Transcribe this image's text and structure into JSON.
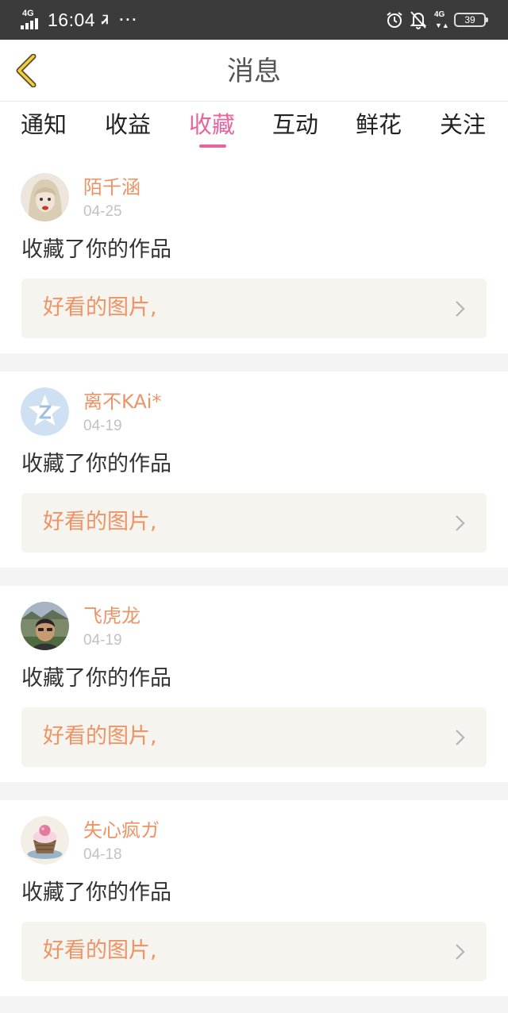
{
  "status_bar": {
    "network_left": "4G",
    "time": "16:04",
    "extra_icon": "Ꮨ",
    "dots": "···",
    "network_right": "4G",
    "battery": "39"
  },
  "header": {
    "title": "消息"
  },
  "tabs": [
    {
      "label": "通知"
    },
    {
      "label": "收益"
    },
    {
      "label": "收藏"
    },
    {
      "label": "互动"
    },
    {
      "label": "鲜花"
    },
    {
      "label": "关注"
    }
  ],
  "active_tab": "收藏",
  "colors": {
    "accent": "#e8649e",
    "username": "#ee9366",
    "work_title": "#ee9366",
    "date": "#c2c2c2",
    "status_bar": "#3b3b3b",
    "card_link_bg": "#f5f4ee"
  },
  "notifications": [
    {
      "username": "陌千涵",
      "date": "04-25",
      "action": "收藏了你的作品",
      "work_title": "好看的图片,",
      "avatar_icon": "avatar-girl-icon"
    },
    {
      "username": "离不KAi*",
      "date": "04-19",
      "action": "收藏了你的作品",
      "work_title": "好看的图片,",
      "avatar_icon": "qzone-default-avatar-icon"
    },
    {
      "username": "飞虎龙",
      "date": "04-19",
      "action": "收藏了你的作品",
      "work_title": "好看的图片,",
      "avatar_icon": "avatar-man-icon"
    },
    {
      "username": "失心疯ガ",
      "date": "04-18",
      "action": "收藏了你的作品",
      "work_title": "好看的图片,",
      "avatar_icon": "avatar-cupcake-icon"
    }
  ]
}
